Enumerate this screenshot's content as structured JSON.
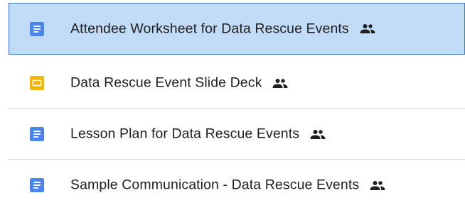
{
  "files": [
    {
      "name": "Attendee Worksheet for Data Rescue Events",
      "type_icon": "google-docs-icon",
      "shared_icon": "shared-people-icon",
      "selected": true
    },
    {
      "name": "Data Rescue Event Slide Deck",
      "type_icon": "google-slides-icon",
      "shared_icon": "shared-people-icon",
      "selected": false
    },
    {
      "name": "Lesson Plan for Data Rescue Events",
      "type_icon": "google-docs-icon",
      "shared_icon": "shared-people-icon",
      "selected": false
    },
    {
      "name": "Sample Communication - Data Rescue Events",
      "type_icon": "google-docs-icon",
      "shared_icon": "shared-people-icon",
      "selected": false
    }
  ],
  "colors": {
    "docs_blue": "#4a86e8",
    "slides_yellow": "#f4b400",
    "selected_background": "#c2dcf8",
    "selected_border": "#3f74c9",
    "text": "#1f1f1f",
    "divider": "#d5d5d5"
  }
}
